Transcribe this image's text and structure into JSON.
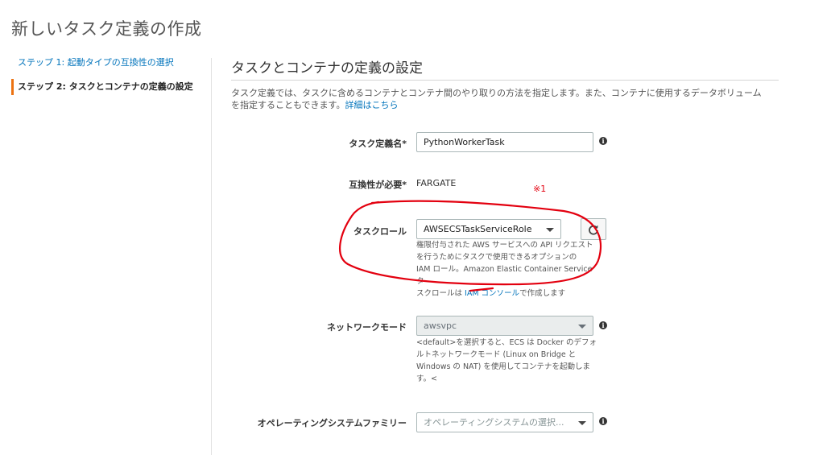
{
  "page": {
    "title": "新しいタスク定義の作成"
  },
  "steps": [
    {
      "label": "ステップ 1: 起動タイプの互換性の選択"
    },
    {
      "label": "ステップ 2: タスクとコンテナの定義の設定"
    }
  ],
  "section": {
    "title": "タスクとコンテナの定義の設定",
    "description_line1": "タスク定義では、タスクに含めるコンテナとコンテナ間のやり取りの方法を指定します。また、コンテナに使用するデータボリューム",
    "description_line2": "を指定することもできます。",
    "details_link": "詳細はこちら"
  },
  "form": {
    "task_name": {
      "label": "タスク定義名*",
      "value": "PythonWorkerTask"
    },
    "compatibility": {
      "label": "互換性が必要*",
      "value": "FARGATE"
    },
    "annotation": "※1",
    "task_role": {
      "label": "タスクロール",
      "value": "AWSECSTaskServiceRole",
      "help_1": "権限付与された AWS サービスへの API リクエスト",
      "help_2": "を行うためにタスクで使用できるオプションの",
      "help_3": "IAM ロール。Amazon Elastic Container Service タ",
      "help_4_pre": "スクロールは ",
      "help_4_link": "IAM コンソール",
      "help_4_post": "で作成します"
    },
    "network_mode": {
      "label": "ネットワークモード",
      "value": "awsvpc",
      "help_1": "<default>を選択すると、ECS は Docker のデフォ",
      "help_2": "ルトネットワークモード (Linux on Bridge と",
      "help_3": "Windows の NAT) を使用してコンテナを起動しま",
      "help_4": "す。<"
    },
    "os_family": {
      "label": "オペレーティングシステムファミリー",
      "placeholder": "オペレーティングシステムの選択..."
    }
  },
  "icons": {
    "info": "info-icon",
    "refresh": "refresh-icon",
    "dropdown": "chevron-down-icon"
  },
  "colors": {
    "link": "#0073bb",
    "active_step": "#ec7211",
    "annotation": "#e3000f"
  }
}
